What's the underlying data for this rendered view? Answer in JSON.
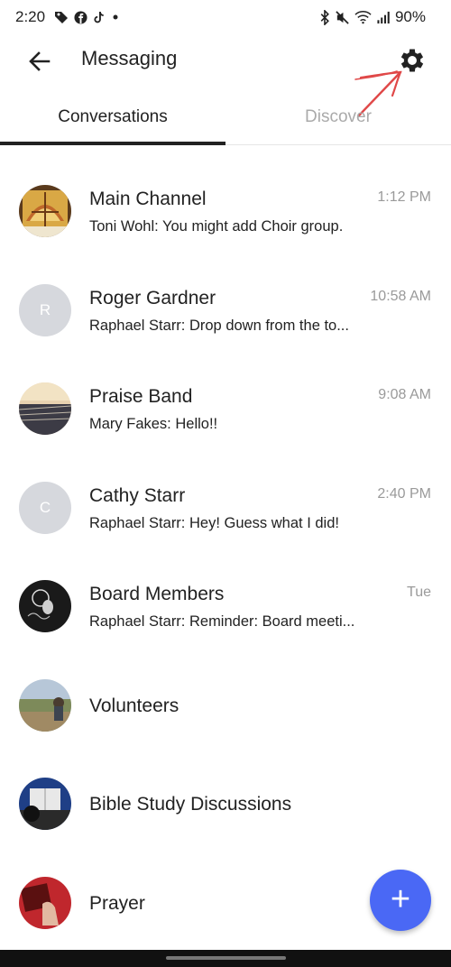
{
  "status_bar": {
    "time": "2:20",
    "battery": "90%",
    "icons_left": [
      "tag-icon",
      "facebook-icon",
      "tiktok-icon",
      "dot-icon"
    ],
    "icons_right": [
      "bluetooth-icon",
      "mute-icon",
      "wifi-icon",
      "signal-icon"
    ]
  },
  "app_bar": {
    "title": "Messaging"
  },
  "tabs": [
    {
      "label": "Conversations",
      "active": true
    },
    {
      "label": "Discover",
      "active": false
    }
  ],
  "conversations": [
    {
      "name": "Main Channel",
      "preview": "Toni Wohl: You might add Choir group.",
      "time": "1:12 PM",
      "avatar": "image"
    },
    {
      "name": "Roger Gardner",
      "preview": "Raphael Starr: Drop down from the to...",
      "time": "10:58 AM",
      "avatar": "R"
    },
    {
      "name": "Praise Band",
      "preview": "Mary Fakes: Hello!!",
      "time": "9:08 AM",
      "avatar": "image"
    },
    {
      "name": "Cathy Starr",
      "preview": "Raphael Starr: Hey! Guess what I did!",
      "time": "2:40 PM",
      "avatar": "C"
    },
    {
      "name": "Board Members",
      "preview": "Raphael Starr: Reminder: Board meeti...",
      "time": "Tue",
      "avatar": "image"
    },
    {
      "name": "Volunteers",
      "preview": "",
      "time": "",
      "avatar": "image"
    },
    {
      "name": "Bible Study Discussions",
      "preview": "",
      "time": "",
      "avatar": "image"
    },
    {
      "name": "Prayer",
      "preview": "",
      "time": "",
      "avatar": "image"
    }
  ],
  "fab": {
    "icon": "plus-icon"
  },
  "colors": {
    "accent": "#4a68f5",
    "annotation": "#e04848",
    "muted": "#9a9a9a"
  }
}
